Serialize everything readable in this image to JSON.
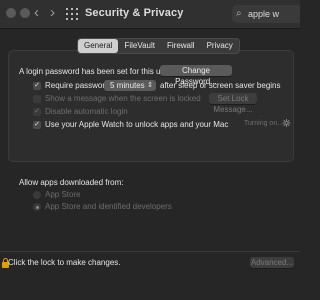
{
  "window": {
    "title": "Security & Privacy",
    "search_value": "apple w"
  },
  "tabs": [
    "General",
    "FileVault",
    "Firewall",
    "Privacy"
  ],
  "general": {
    "password_label": "A login password has been set for this user",
    "change_password_button": "Change Password...",
    "require_password_label": "Require password",
    "require_password_checked": true,
    "require_password_select_value": "5 minutes",
    "require_password_suffix": "after sleep or screen saver begins",
    "show_message_label": "Show a message when the screen is locked",
    "show_message_checked": false,
    "set_lock_message_button": "Set Lock Message...",
    "disable_auto_login_label": "Disable automatic login",
    "disable_auto_login_checked": true,
    "apple_watch_label": "Use your Apple Watch to unlock apps and your Mac",
    "apple_watch_checked": true,
    "apple_watch_status": "Turning on..."
  },
  "downloads": {
    "heading": "Allow apps downloaded from:",
    "options": [
      "App Store",
      "App Store and identified developers"
    ],
    "selected_index": 1
  },
  "bottom": {
    "lock_label": "Click the lock to make changes.",
    "advanced_button": "Advanced..."
  },
  "colors": {
    "background": "#262626",
    "lock_icon": "#e0a000"
  }
}
